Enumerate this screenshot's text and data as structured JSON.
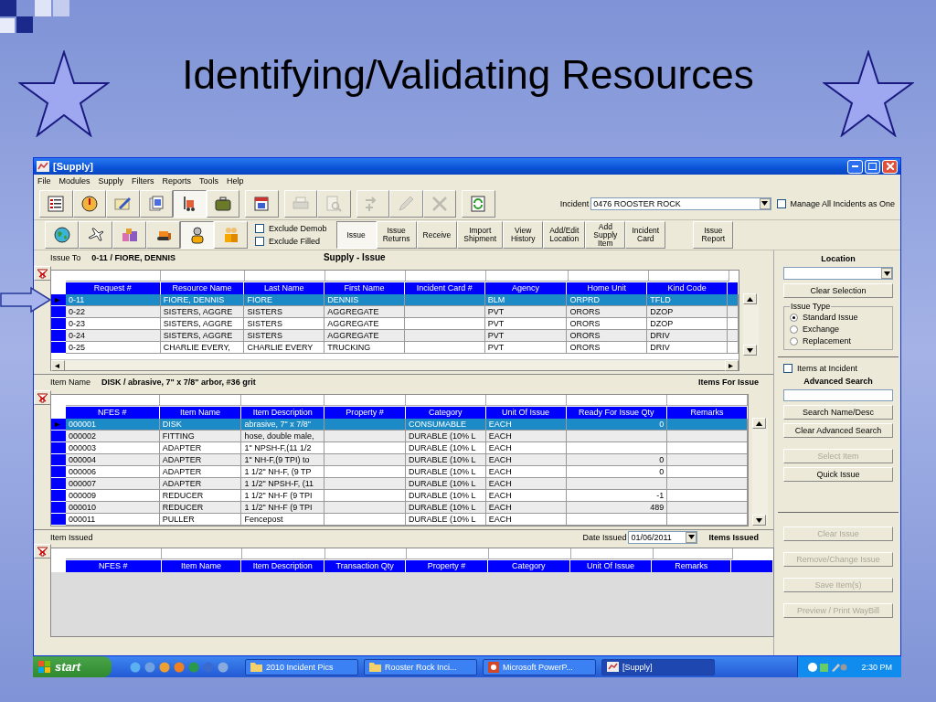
{
  "slide": {
    "title": "Identifying/Validating Resources"
  },
  "window": {
    "title": "[Supply]"
  },
  "menu": [
    "File",
    "Modules",
    "Supply",
    "Filters",
    "Reports",
    "Tools",
    "Help"
  ],
  "toolbar_1": {
    "tools": [
      {
        "kind": "checklist",
        "disabled": false,
        "selected": false
      },
      {
        "kind": "gauge",
        "disabled": false,
        "selected": false
      },
      {
        "kind": "notepad",
        "disabled": false,
        "selected": false
      },
      {
        "kind": "documents",
        "disabled": false,
        "selected": false
      },
      {
        "kind": "forklift",
        "disabled": false,
        "selected": true
      },
      {
        "kind": "suitcase",
        "disabled": false,
        "selected": false
      },
      {
        "kind": "calendar",
        "disabled": false,
        "selected": false
      },
      {
        "kind": "printer",
        "disabled": true,
        "selected": false
      },
      {
        "kind": "preview",
        "disabled": true,
        "selected": false
      },
      {
        "kind": "arrows",
        "disabled": true,
        "selected": false
      },
      {
        "kind": "pencil",
        "disabled": true,
        "selected": false
      },
      {
        "kind": "cross",
        "disabled": true,
        "selected": false
      },
      {
        "kind": "refresh",
        "disabled": false,
        "selected": false
      }
    ],
    "incident": {
      "label": "Incident",
      "value": "0476  ROOSTER ROCK"
    },
    "manage_all": {
      "label": "Manage All Incidents as One",
      "checked": false
    }
  },
  "toolbar_2": {
    "tools": [
      {
        "kind": "globe",
        "selected": false
      },
      {
        "kind": "airplane",
        "selected": false
      },
      {
        "kind": "boxes",
        "selected": false
      },
      {
        "kind": "bulldozer",
        "selected": false
      },
      {
        "kind": "person",
        "selected": true
      },
      {
        "kind": "people",
        "selected": false
      }
    ],
    "filters": [
      {
        "label": "Exclude Demob",
        "checked": false
      },
      {
        "label": "Exclude Filled",
        "checked": false
      }
    ],
    "actions": [
      {
        "label": "Issue",
        "selected": true
      },
      {
        "label": "Issue\nReturns",
        "selected": false
      },
      {
        "label": "Receive",
        "selected": false
      },
      {
        "label": "Import\nShipment",
        "selected": false
      },
      {
        "label": "View\nHistory",
        "selected": false
      },
      {
        "label": "Add/Edit\nLocation",
        "selected": false
      },
      {
        "label": "Add\nSupply\nItem",
        "selected": false
      },
      {
        "label": "Incident\nCard",
        "selected": false
      }
    ],
    "report_button": "Issue\nReport"
  },
  "issue_to": {
    "label": "Issue To",
    "value": "0-11 / FIORE, DENNIS",
    "title": "Supply - Issue"
  },
  "requests": {
    "columns": [
      "Request #",
      "Resource Name",
      "Last Name",
      "First Name",
      "Incident Card #",
      "Agency",
      "Home Unit",
      "Kind Code"
    ],
    "rows": [
      {
        "selected": true,
        "cells": [
          "0-11",
          "FIORE, DENNIS",
          "FIORE",
          "DENNIS",
          null,
          "BLM",
          "ORPRD",
          "TFLD"
        ]
      },
      {
        "selected": false,
        "cells": [
          "0-22",
          "SISTERS, AGGRE",
          "SISTERS",
          "AGGREGATE",
          null,
          "PVT",
          "ORORS",
          "DZOP"
        ]
      },
      {
        "selected": false,
        "cells": [
          "0-23",
          "SISTERS, AGGRE",
          "SISTERS",
          "AGGREGATE",
          null,
          "PVT",
          "ORORS",
          "DZOP"
        ]
      },
      {
        "selected": false,
        "cells": [
          "0-24",
          "SISTERS, AGGRE",
          "SISTERS",
          "AGGREGATE",
          null,
          "PVT",
          "ORORS",
          "DRIV"
        ]
      },
      {
        "selected": false,
        "cells": [
          "0-25",
          "CHARLIE EVERY,",
          "CHARLIE EVERY",
          "TRUCKING",
          null,
          "PVT",
          "ORORS",
          "DRIV"
        ]
      }
    ]
  },
  "item": {
    "label": "Item Name",
    "value": "DISK / abrasive, 7\" x 7/8\" arbor, #36 grit",
    "title": "Items For Issue"
  },
  "items": {
    "columns": [
      "NFES #",
      "Item Name",
      "Item Description",
      "Property #",
      "Category",
      "Unit Of Issue",
      "Ready For Issue Qty",
      "Remarks"
    ],
    "rows": [
      {
        "selected": true,
        "cells": [
          "000001",
          "DISK",
          "abrasive, 7\" x 7/8\"",
          null,
          "CONSUMABLE",
          "EACH",
          "0",
          null
        ]
      },
      {
        "selected": false,
        "cells": [
          "000002",
          "FITTING",
          "hose, double male,",
          null,
          "DURABLE (10% L",
          "EACH",
          null,
          null
        ]
      },
      {
        "selected": false,
        "cells": [
          "000003",
          "ADAPTER",
          "1\" NPSH-F,(11 1/2",
          null,
          "DURABLE (10% L",
          "EACH",
          null,
          null
        ]
      },
      {
        "selected": false,
        "cells": [
          "000004",
          "ADAPTER",
          "1\" NH-F,(9 TPI) to",
          null,
          "DURABLE (10% L",
          "EACH",
          "0",
          null
        ]
      },
      {
        "selected": false,
        "cells": [
          "000006",
          "ADAPTER",
          "1 1/2\" NH-F, (9 TP",
          null,
          "DURABLE (10% L",
          "EACH",
          "0",
          null
        ]
      },
      {
        "selected": false,
        "cells": [
          "000007",
          "ADAPTER",
          "1 1/2\" NPSH-F, (11",
          null,
          "DURABLE (10% L",
          "EACH",
          null,
          null
        ]
      },
      {
        "selected": false,
        "cells": [
          "000009",
          "REDUCER",
          "1 1/2\" NH-F (9 TPI",
          null,
          "DURABLE (10% L",
          "EACH",
          "-1",
          null
        ]
      },
      {
        "selected": false,
        "cells": [
          "000010",
          "REDUCER",
          "1 1/2\" NH-F (9 TPI",
          null,
          "DURABLE (10% L",
          "EACH",
          "489",
          null
        ]
      },
      {
        "selected": false,
        "cells": [
          "000011",
          "PULLER",
          "Fencepost",
          null,
          "DURABLE (10% L",
          "EACH",
          null,
          null
        ]
      }
    ]
  },
  "issued": {
    "label": "Item Issued",
    "date_label": "Date Issued",
    "date": "01/06/2011",
    "title": "Items Issued",
    "columns": [
      "NFES #",
      "Item Name",
      "Item Description",
      "Transaction Qty",
      "Property #",
      "Category",
      "Unit Of Issue",
      "Remarks"
    ]
  },
  "side_panel": {
    "location_title": "Location",
    "clear_selection": "Clear Selection",
    "issue_type": {
      "label": "Issue Type",
      "options": [
        {
          "label": "Standard Issue",
          "selected": true
        },
        {
          "label": "Exchange",
          "selected": false
        },
        {
          "label": "Replacement",
          "selected": false
        }
      ]
    },
    "items_at_incident": {
      "label": "Items at Incident",
      "checked": false
    },
    "advanced_search": "Advanced Search",
    "search_buttons": [
      {
        "label": "Search Name/Desc",
        "disabled": false
      },
      {
        "label": "Clear Advanced Search",
        "disabled": false
      },
      {
        "label": "Select Item",
        "disabled": true
      },
      {
        "label": "Quick Issue",
        "disabled": false
      }
    ],
    "issue_buttons": [
      {
        "label": "Clear Issue",
        "disabled": true
      },
      {
        "label": "Remove/Change Issue",
        "disabled": true
      },
      {
        "label": "Save Item(s)",
        "disabled": true
      },
      {
        "label": "Preview / Print WayBill",
        "disabled": true
      }
    ]
  },
  "taskbar": {
    "start": "start",
    "tasks": [
      {
        "label": "2010 Incident Pics",
        "kind": "folder",
        "selected": false
      },
      {
        "label": "Rooster Rock Inci...",
        "kind": "folder",
        "selected": false
      },
      {
        "label": "Microsoft PowerP...",
        "kind": "slides",
        "selected": false
      },
      {
        "label": "[Supply]",
        "kind": "app",
        "selected": true
      }
    ],
    "clock": "2:30 PM"
  }
}
